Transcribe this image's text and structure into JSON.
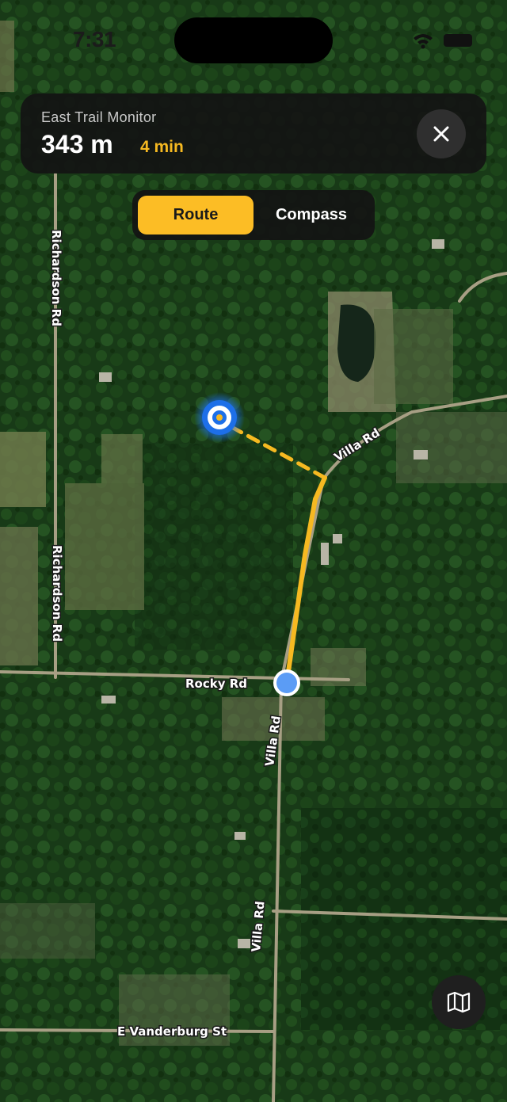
{
  "status_bar": {
    "time": "7:31"
  },
  "header_card": {
    "title": "East Trail Monitor",
    "distance": "343 m",
    "eta": "4 min"
  },
  "mode_toggle": {
    "options": [
      "Route",
      "Compass"
    ],
    "selected": "Route"
  },
  "map": {
    "type": "satellite",
    "road_labels": [
      "Richardson Rd",
      "Richardson Rd",
      "Villa Rd",
      "Rocky Rd",
      "Villa Rd",
      "Villa Rd",
      "E Vanderburg St"
    ]
  },
  "colors": {
    "accent": "#fcbd25",
    "card_bg": "#141414",
    "route": "#f6b921",
    "user_dot": "#5b9cf5",
    "target": "#1d6fe8"
  },
  "icons": {
    "close": "close-icon",
    "layers": "map-icon",
    "target": "target-marker-icon",
    "location": "current-location-icon"
  }
}
